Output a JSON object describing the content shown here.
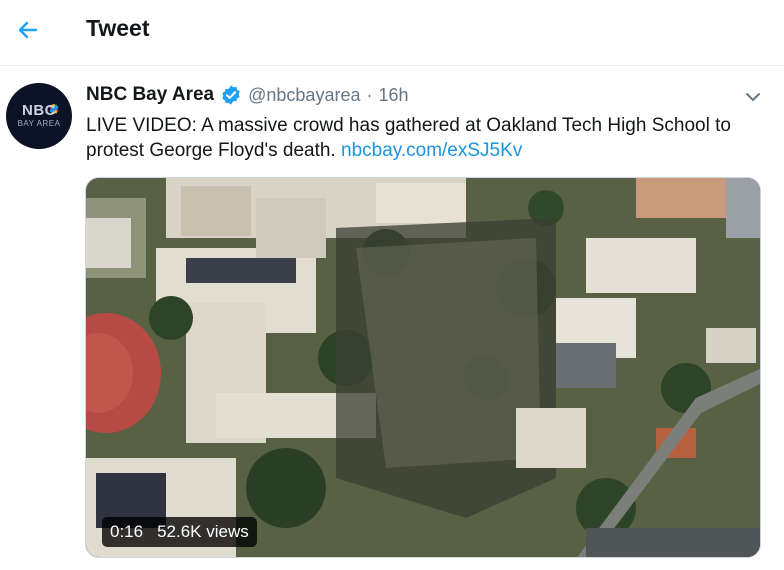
{
  "header": {
    "title": "Tweet",
    "back_icon": "arrow-left-icon",
    "accent": "#1da1f2"
  },
  "avatar": {
    "line1": "NBC",
    "line2": "BAY AREA"
  },
  "tweet": {
    "display_name": "NBC Bay Area",
    "verified_icon": "verified-badge-icon",
    "handle": "@nbcbayarea",
    "separator": "·",
    "time": "16h",
    "text": "LIVE VIDEO: A massive crowd has gathered at Oakland Tech High School to protest George Floyd's death. ",
    "link": "nbcbay.com/exSJ5Kv",
    "link_color": "#1b95e0",
    "menu_icon": "chevron-down-icon"
  },
  "media": {
    "duration": "0:16",
    "views": "52.6K views"
  }
}
